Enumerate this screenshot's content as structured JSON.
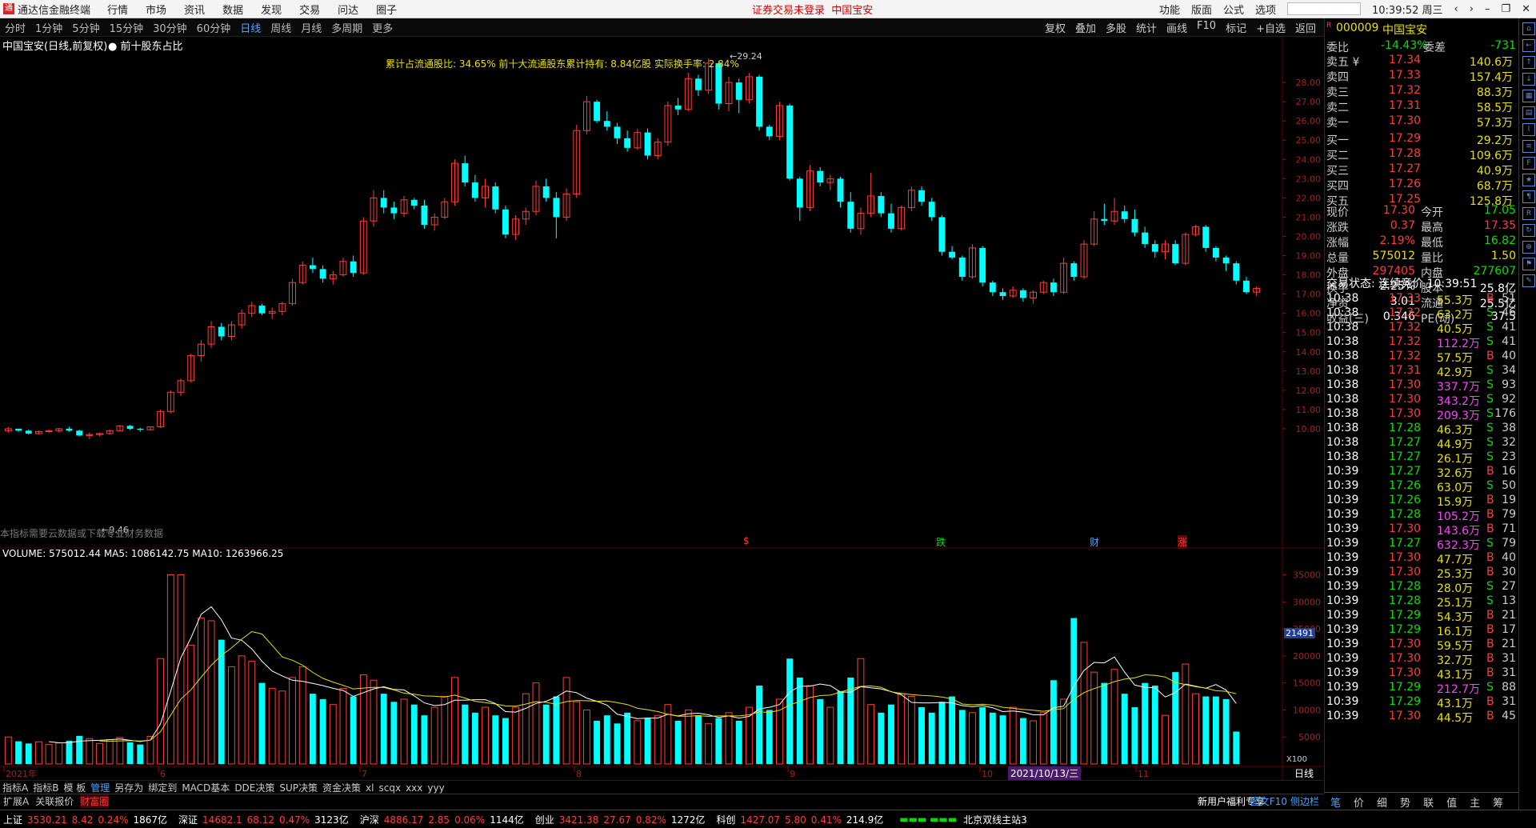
{
  "menu": {
    "app_title": "通达信金融终端",
    "items": [
      "行情",
      "市场",
      "资讯",
      "数据",
      "发现",
      "交易",
      "问达",
      "圈子"
    ],
    "center_notice": "证券交易未登录",
    "center_stock": "中国宝安",
    "right_items": [
      "功能",
      "版面",
      "公式",
      "选项"
    ],
    "clock": "10:39:52 周三"
  },
  "toolbar": {
    "periods": [
      "分时",
      "1分钟",
      "5分钟",
      "15分钟",
      "30分钟",
      "60分钟",
      "日线",
      "周线",
      "月线",
      "多周期",
      "更多"
    ],
    "active_period": "日线",
    "right_items": [
      "复权",
      "叠加",
      "多股",
      "统计",
      "画线",
      "F10",
      "标记",
      "+自选",
      "返回"
    ]
  },
  "chart": {
    "title": "中国宝安(日线,前复权)",
    "overlay": "前十股东占比",
    "annotation": "累计占流通股比: 34.65%   前十大流通股东累计持有: 8.84亿股   实际换手率: 2.84%",
    "high_label": "29.24",
    "low_label": "9.46",
    "note": "本指标需要云数据或下载专业财务数据",
    "event_markers": [
      "$",
      "跌",
      "财",
      "涨"
    ],
    "price_ticks": [
      "28.00",
      "27.00",
      "26.00",
      "25.00",
      "24.00",
      "23.00",
      "22.00",
      "21.00",
      "20.00",
      "19.00",
      "18.00",
      "17.00",
      "16.00",
      "15.00",
      "14.00",
      "13.00",
      "12.00",
      "11.00",
      "10.00"
    ],
    "volume_title": "VOLUME: 575012.44  MA5: 1086142.75  MA10: 1263966.25",
    "volume_ticks": [
      "35000",
      "30000",
      "25000",
      "20000",
      "15000",
      "10000",
      "5000"
    ],
    "volume_marker": "21491",
    "volume_unit": "X100",
    "x_labels": [
      "2021年",
      "6",
      "7",
      "8",
      "9",
      "10",
      "11"
    ],
    "date_cursor": "2021/10/13/三",
    "bottom_label": "日线"
  },
  "chart_data": {
    "type": "candlestick",
    "title": "中国宝安(日线,前复权)",
    "candles": [
      [
        9.9,
        10.1,
        9.8,
        10.0
      ],
      [
        10.0,
        10.0,
        9.85,
        9.9
      ],
      [
        9.9,
        9.95,
        9.7,
        9.75
      ],
      [
        9.75,
        9.9,
        9.7,
        9.85
      ],
      [
        9.85,
        9.95,
        9.8,
        9.9
      ],
      [
        9.9,
        10.05,
        9.8,
        10.0
      ],
      [
        10.0,
        10.1,
        9.85,
        9.9
      ],
      [
        9.9,
        9.95,
        9.6,
        9.65
      ],
      [
        9.65,
        9.8,
        9.46,
        9.7
      ],
      [
        9.7,
        9.8,
        9.6,
        9.75
      ],
      [
        9.75,
        9.95,
        9.7,
        9.9
      ],
      [
        9.9,
        10.2,
        9.85,
        10.15
      ],
      [
        10.15,
        10.2,
        9.95,
        10.0
      ],
      [
        10.0,
        10.05,
        9.85,
        9.95
      ],
      [
        9.95,
        10.1,
        9.9,
        10.1
      ],
      [
        10.1,
        11.0,
        10.05,
        10.9
      ],
      [
        10.9,
        12.0,
        10.8,
        11.9
      ],
      [
        11.9,
        12.6,
        11.7,
        12.5
      ],
      [
        12.5,
        13.9,
        12.4,
        13.8
      ],
      [
        13.8,
        14.6,
        13.5,
        14.4
      ],
      [
        14.4,
        15.6,
        14.2,
        15.3
      ],
      [
        15.3,
        15.5,
        14.6,
        14.8
      ],
      [
        14.8,
        15.6,
        14.6,
        15.4
      ],
      [
        15.4,
        16.2,
        15.2,
        16.0
      ],
      [
        16.0,
        16.6,
        15.8,
        16.4
      ],
      [
        16.4,
        16.5,
        15.9,
        16.0
      ],
      [
        16.0,
        16.3,
        15.7,
        16.1
      ],
      [
        16.1,
        16.6,
        15.9,
        16.5
      ],
      [
        16.5,
        17.8,
        16.4,
        17.6
      ],
      [
        17.6,
        18.7,
        17.5,
        18.5
      ],
      [
        18.5,
        18.9,
        18.1,
        18.3
      ],
      [
        18.3,
        18.5,
        17.6,
        17.8
      ],
      [
        17.8,
        18.2,
        17.5,
        18.0
      ],
      [
        18.0,
        18.9,
        17.9,
        18.7
      ],
      [
        18.7,
        19.0,
        17.9,
        18.1
      ],
      [
        18.1,
        21.0,
        18.0,
        20.8
      ],
      [
        20.8,
        22.4,
        20.5,
        22.0
      ],
      [
        22.0,
        22.4,
        21.2,
        21.5
      ],
      [
        21.5,
        21.8,
        20.9,
        21.2
      ],
      [
        21.2,
        22.1,
        21.0,
        21.9
      ],
      [
        21.9,
        22.0,
        21.4,
        21.6
      ],
      [
        21.6,
        21.9,
        20.4,
        20.6
      ],
      [
        20.6,
        21.2,
        20.3,
        21.0
      ],
      [
        21.0,
        22.0,
        20.9,
        21.8
      ],
      [
        21.8,
        24.0,
        21.6,
        23.8
      ],
      [
        23.8,
        24.2,
        22.6,
        22.8
      ],
      [
        22.8,
        23.2,
        21.8,
        22.0
      ],
      [
        22.0,
        23.0,
        21.5,
        22.6
      ],
      [
        22.6,
        22.8,
        21.2,
        21.4
      ],
      [
        21.4,
        21.6,
        19.9,
        20.1
      ],
      [
        20.1,
        21.1,
        19.8,
        20.9
      ],
      [
        20.9,
        21.5,
        20.6,
        21.3
      ],
      [
        21.3,
        22.9,
        21.1,
        22.6
      ],
      [
        22.6,
        23.0,
        21.8,
        22.0
      ],
      [
        22.0,
        22.3,
        19.9,
        21.0
      ],
      [
        21.0,
        22.5,
        20.8,
        22.2
      ],
      [
        22.2,
        25.8,
        22.0,
        25.5
      ],
      [
        25.5,
        27.3,
        25.3,
        27.0
      ],
      [
        27.0,
        27.1,
        25.9,
        26.0
      ],
      [
        26.0,
        26.5,
        25.5,
        25.7
      ],
      [
        25.7,
        25.9,
        24.8,
        25.1
      ],
      [
        25.1,
        25.5,
        24.4,
        24.6
      ],
      [
        24.6,
        25.6,
        24.5,
        25.4
      ],
      [
        25.4,
        25.6,
        24.0,
        24.2
      ],
      [
        24.2,
        25.1,
        24.0,
        24.9
      ],
      [
        24.9,
        27.0,
        24.7,
        26.8
      ],
      [
        26.8,
        27.2,
        26.3,
        26.6
      ],
      [
        26.6,
        28.5,
        26.5,
        28.2
      ],
      [
        28.2,
        28.4,
        27.3,
        27.6
      ],
      [
        27.6,
        29.24,
        27.4,
        29.0
      ],
      [
        29.0,
        29.1,
        26.6,
        26.9
      ],
      [
        26.9,
        28.3,
        26.5,
        28.0
      ],
      [
        28.0,
        28.2,
        26.4,
        27.1
      ],
      [
        27.1,
        28.5,
        26.9,
        28.3
      ],
      [
        28.3,
        28.4,
        25.5,
        25.7
      ],
      [
        25.7,
        25.8,
        25.0,
        25.2
      ],
      [
        25.2,
        27.0,
        25.0,
        26.8
      ],
      [
        26.8,
        26.9,
        22.9,
        23.0
      ],
      [
        23.0,
        23.1,
        20.8,
        21.5
      ],
      [
        21.5,
        23.7,
        21.3,
        23.4
      ],
      [
        23.4,
        23.6,
        22.6,
        22.8
      ],
      [
        22.8,
        23.2,
        22.4,
        23.0
      ],
      [
        23.0,
        23.1,
        21.5,
        21.8
      ],
      [
        21.8,
        22.3,
        20.2,
        20.4
      ],
      [
        20.4,
        21.5,
        20.1,
        21.2
      ],
      [
        21.2,
        23.3,
        21.0,
        22.1
      ],
      [
        22.1,
        22.3,
        21.0,
        21.2
      ],
      [
        21.2,
        21.7,
        20.2,
        20.4
      ],
      [
        20.4,
        21.6,
        20.3,
        21.5
      ],
      [
        21.5,
        22.6,
        21.3,
        22.4
      ],
      [
        22.4,
        22.6,
        21.6,
        21.8
      ],
      [
        21.8,
        22.0,
        20.8,
        21.0
      ],
      [
        21.0,
        21.1,
        19.0,
        19.2
      ],
      [
        19.2,
        19.5,
        18.8,
        18.9
      ],
      [
        18.9,
        19.0,
        17.7,
        17.9
      ],
      [
        17.9,
        19.6,
        17.8,
        19.4
      ],
      [
        19.4,
        19.5,
        17.4,
        17.6
      ],
      [
        17.6,
        17.7,
        16.9,
        17.1
      ],
      [
        17.1,
        17.3,
        16.7,
        16.9
      ],
      [
        16.9,
        17.4,
        16.8,
        17.2
      ],
      [
        17.2,
        17.3,
        16.6,
        16.8
      ],
      [
        16.8,
        17.2,
        16.5,
        17.1
      ],
      [
        17.1,
        17.7,
        17.0,
        17.6
      ],
      [
        17.6,
        17.8,
        16.9,
        17.1
      ],
      [
        17.1,
        18.9,
        17.0,
        18.6
      ],
      [
        18.6,
        18.7,
        17.7,
        17.9
      ],
      [
        17.9,
        19.8,
        17.8,
        19.6
      ],
      [
        19.6,
        21.3,
        19.5,
        20.9
      ],
      [
        20.9,
        21.7,
        20.6,
        20.8
      ],
      [
        20.8,
        22.0,
        20.6,
        21.3
      ],
      [
        21.3,
        21.6,
        20.7,
        20.9
      ],
      [
        20.9,
        21.4,
        20.0,
        20.2
      ],
      [
        20.2,
        20.5,
        19.4,
        19.6
      ],
      [
        19.6,
        19.8,
        18.9,
        19.2
      ],
      [
        19.2,
        19.8,
        18.8,
        19.6
      ],
      [
        19.6,
        19.8,
        18.5,
        18.6
      ],
      [
        18.6,
        20.2,
        18.5,
        20.1
      ],
      [
        20.1,
        20.6,
        20.0,
        20.5
      ],
      [
        20.5,
        20.6,
        19.2,
        19.4
      ],
      [
        19.4,
        19.5,
        18.7,
        18.9
      ],
      [
        18.9,
        19.0,
        18.2,
        18.6
      ],
      [
        18.6,
        18.7,
        17.5,
        17.7
      ],
      [
        17.7,
        17.9,
        17.0,
        17.1
      ],
      [
        17.1,
        17.4,
        16.9,
        17.3
      ]
    ],
    "volume": [
      5000,
      4200,
      3800,
      4100,
      3600,
      3900,
      4300,
      5200,
      4700,
      3800,
      4500,
      4900,
      4000,
      3600,
      5100,
      19500,
      35000,
      35000,
      22000,
      27000,
      26500,
      23000,
      18000,
      20000,
      19000,
      15000,
      14000,
      13500,
      16000,
      18000,
      13000,
      12000,
      11000,
      14000,
      12500,
      16500,
      15500,
      13000,
      11500,
      12000,
      11000,
      9000,
      10500,
      12500,
      16000,
      11000,
      9500,
      10500,
      9000,
      8500,
      10500,
      13000,
      15000,
      11000,
      12500,
      16000,
      11500,
      10000,
      8000,
      9000,
      7500,
      9500,
      8000,
      8500,
      9000,
      11000,
      8000,
      10000,
      9000,
      7500,
      8500,
      9500,
      8000,
      10500,
      14500,
      10000,
      12000,
      19500,
      16000,
      14500,
      12000,
      10500,
      13500,
      16000,
      19500,
      11000,
      9500,
      11000,
      13000,
      12500,
      10500,
      9500,
      11500,
      12500,
      10000,
      9500,
      10500,
      9500,
      9000,
      10500,
      8500,
      8000,
      9500,
      15500,
      12000,
      27000,
      22500,
      17000,
      15000,
      17500,
      13000,
      10500,
      15000,
      14500,
      9000,
      17000,
      18500,
      13000,
      12500,
      12500,
      12000,
      6000
    ],
    "ylim": [
      9.0,
      30.0
    ],
    "ylabel": "",
    "xlabel": ""
  },
  "quote": {
    "code": "000009",
    "name": "中国宝安",
    "weibi_label": "委比",
    "weibi": "-14.43%",
    "weicha_label": "委差",
    "weicha": "-731",
    "asks": [
      {
        "label": "卖五 ¥",
        "price": "17.34",
        "vol": "140.6万"
      },
      {
        "label": "卖四",
        "price": "17.33",
        "vol": "157.4万"
      },
      {
        "label": "卖三",
        "price": "17.32",
        "vol": "88.3万"
      },
      {
        "label": "卖二",
        "price": "17.31",
        "vol": "58.5万"
      },
      {
        "label": "卖一",
        "price": "17.30",
        "vol": "57.3万"
      }
    ],
    "bids": [
      {
        "label": "买一",
        "price": "17.29",
        "vol": "29.2万"
      },
      {
        "label": "买二",
        "price": "17.28",
        "vol": "109.6万"
      },
      {
        "label": "买三",
        "price": "17.27",
        "vol": "40.9万"
      },
      {
        "label": "买四",
        "price": "17.26",
        "vol": "68.7万"
      },
      {
        "label": "买五",
        "price": "17.25",
        "vol": "125.8万"
      }
    ],
    "stats": [
      {
        "l1": "现价",
        "v1": "17.30",
        "l2": "今开",
        "v2": "17.05",
        "c1": "red",
        "c2": "green"
      },
      {
        "l1": "涨跌",
        "v1": "0.37",
        "l2": "最高",
        "v2": "17.35",
        "c1": "red",
        "c2": "red"
      },
      {
        "l1": "涨幅",
        "v1": "2.19%",
        "l2": "最低",
        "v2": "16.82",
        "c1": "red",
        "c2": "green"
      },
      {
        "l1": "总量",
        "v1": "575012",
        "l2": "量比",
        "v2": "1.50",
        "c1": "yellow",
        "c2": "yellow"
      },
      {
        "l1": "外盘",
        "v1": "297405",
        "l2": "内盘",
        "v2": "277607",
        "c1": "red",
        "c2": "green"
      },
      {
        "l1": "换手",
        "v1": "2.25%",
        "l2": "股本",
        "v2": "25.8亿",
        "c1": "white",
        "c2": "white"
      },
      {
        "l1": "净资",
        "v1": "3.01",
        "l2": "流通",
        "v2": "25.5亿",
        "c1": "white",
        "c2": "white"
      },
      {
        "l1": "收益(三)",
        "v1": "0.346",
        "l2": "PE(动)",
        "v2": "37.5",
        "c1": "white",
        "c2": "white"
      }
    ],
    "trade_status": "交易状态: 连续竞价 10:39:51",
    "ticks": [
      [
        "10:38",
        "17.33",
        "55.3万",
        "B",
        "51"
      ],
      [
        "10:38",
        "17.32",
        "63.2万",
        "S",
        "46"
      ],
      [
        "10:38",
        "17.32",
        "40.5万",
        "S",
        "41"
      ],
      [
        "10:38",
        "17.32",
        "112.2万",
        "S",
        "41"
      ],
      [
        "10:38",
        "17.32",
        "57.5万",
        "B",
        "40"
      ],
      [
        "10:38",
        "17.31",
        "42.9万",
        "S",
        "34"
      ],
      [
        "10:38",
        "17.30",
        "337.7万",
        "S",
        "93"
      ],
      [
        "10:38",
        "17.30",
        "343.2万",
        "S",
        "92"
      ],
      [
        "10:38",
        "17.30",
        "209.3万",
        "S",
        "176"
      ],
      [
        "10:38",
        "17.28",
        "46.3万",
        "S",
        "38"
      ],
      [
        "10:38",
        "17.27",
        "44.9万",
        "S",
        "32"
      ],
      [
        "10:38",
        "17.27",
        "26.1万",
        "S",
        "23"
      ],
      [
        "10:39",
        "17.27",
        "32.6万",
        "B",
        "16"
      ],
      [
        "10:39",
        "17.26",
        "63.0万",
        "S",
        "50"
      ],
      [
        "10:39",
        "17.26",
        "15.9万",
        "B",
        "19"
      ],
      [
        "10:39",
        "17.28",
        "105.2万",
        "B",
        "79"
      ],
      [
        "10:39",
        "17.30",
        "143.6万",
        "B",
        "71"
      ],
      [
        "10:39",
        "17.27",
        "632.3万",
        "S",
        "79"
      ],
      [
        "10:39",
        "17.30",
        "47.7万",
        "B",
        "40"
      ],
      [
        "10:39",
        "17.30",
        "25.3万",
        "B",
        "30"
      ],
      [
        "10:39",
        "17.28",
        "28.0万",
        "S",
        "27"
      ],
      [
        "10:39",
        "17.28",
        "25.1万",
        "S",
        "13"
      ],
      [
        "10:39",
        "17.29",
        "54.3万",
        "B",
        "21"
      ],
      [
        "10:39",
        "17.29",
        "16.1万",
        "B",
        "17"
      ],
      [
        "10:39",
        "17.30",
        "59.5万",
        "B",
        "21"
      ],
      [
        "10:39",
        "17.30",
        "32.7万",
        "B",
        "31"
      ],
      [
        "10:39",
        "17.30",
        "43.1万",
        "B",
        "31"
      ],
      [
        "10:39",
        "17.29",
        "212.7万",
        "S",
        "88"
      ],
      [
        "10:39",
        "17.29",
        "43.1万",
        "B",
        "31"
      ],
      [
        "10:39",
        "17.30",
        "44.5万",
        "B",
        "45"
      ]
    ]
  },
  "bottom": {
    "tabs": [
      "指标A",
      "指标B",
      "模 板",
      "管理",
      "另存为",
      "绑定到",
      "MACD基本",
      "DDE决策",
      "SUP决策",
      "资金决策",
      "xl",
      "scqx",
      "xxx",
      "yyy"
    ],
    "selected_tab": "管理",
    "tabs2": [
      "扩展A",
      "关联报价",
      "财富圈"
    ],
    "promo": "新用户福利专享",
    "promo2": "图文F10",
    "promo3": "侧边栏",
    "panel_tabs": [
      "笔",
      "价",
      "细",
      "势",
      "联",
      "值",
      "主",
      "筹"
    ]
  },
  "status": {
    "items": [
      {
        "name": "上证",
        "val": "3530.21",
        "chg": "8.42",
        "pct": "0.24%",
        "amt": "1867亿"
      },
      {
        "name": "深证",
        "val": "14682.1",
        "chg": "68.12",
        "pct": "0.47%",
        "amt": "3123亿"
      },
      {
        "name": "沪深",
        "val": "4886.17",
        "chg": "2.85",
        "pct": "0.06%",
        "amt": "1144亿"
      },
      {
        "name": "创业",
        "val": "3421.38",
        "chg": "27.67",
        "pct": "0.82%",
        "amt": "1272亿"
      },
      {
        "name": "科创",
        "val": "1427.07",
        "chg": "5.80",
        "pct": "0.41%",
        "amt": "214.9亿"
      }
    ],
    "server": "北京双线主站3"
  },
  "sidebar_icons": [
    "home-icon",
    "back-icon",
    "up-icon",
    "down-icon",
    "grid-icon",
    "grid2-icon",
    "chart-icon",
    "list-icon",
    "f10-icon",
    "star-icon",
    "news-icon",
    "rsi-icon",
    "refresh-icon",
    "zoom-icon",
    "flag-icon",
    "pen-icon"
  ],
  "colors": {
    "up": "#ff3b3b",
    "down": "#00ffff",
    "grid": "#600000",
    "ma5": "#ffffff",
    "ma10": "#e8e000"
  }
}
